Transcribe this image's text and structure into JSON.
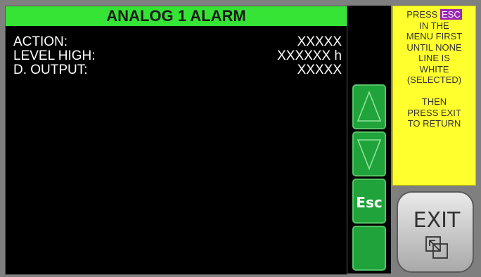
{
  "screen": {
    "title": "ANALOG 1 ALARM",
    "rows": [
      {
        "label": "ACTION:",
        "value": "XXXXX"
      },
      {
        "label": "LEVEL HIGH:",
        "value": "XXXXXX h"
      },
      {
        "label": "D. OUTPUT:",
        "value": "XXXXX"
      }
    ]
  },
  "buttons": {
    "up_icon": "triangle-up-icon",
    "down_icon": "triangle-down-icon",
    "esc_label": "Esc",
    "blank_icon": "empty"
  },
  "help": {
    "press": "PRESS",
    "esc_tag": "ESC",
    "lines": [
      "IN THE",
      "MENU FIRST",
      "UNTIL NONE",
      "LINE IS",
      "WHITE",
      "(SELECTED)",
      "",
      "THEN",
      "PRESS EXIT",
      "TO RETURN"
    ]
  },
  "exit": {
    "label": "EXIT",
    "icon": "exit-arrow-icon"
  },
  "colors": {
    "title_bg": "#36e436",
    "button_green": "#1fa33a",
    "help_bg": "#ffff2e",
    "esc_tag_bg": "#9b26b6"
  }
}
